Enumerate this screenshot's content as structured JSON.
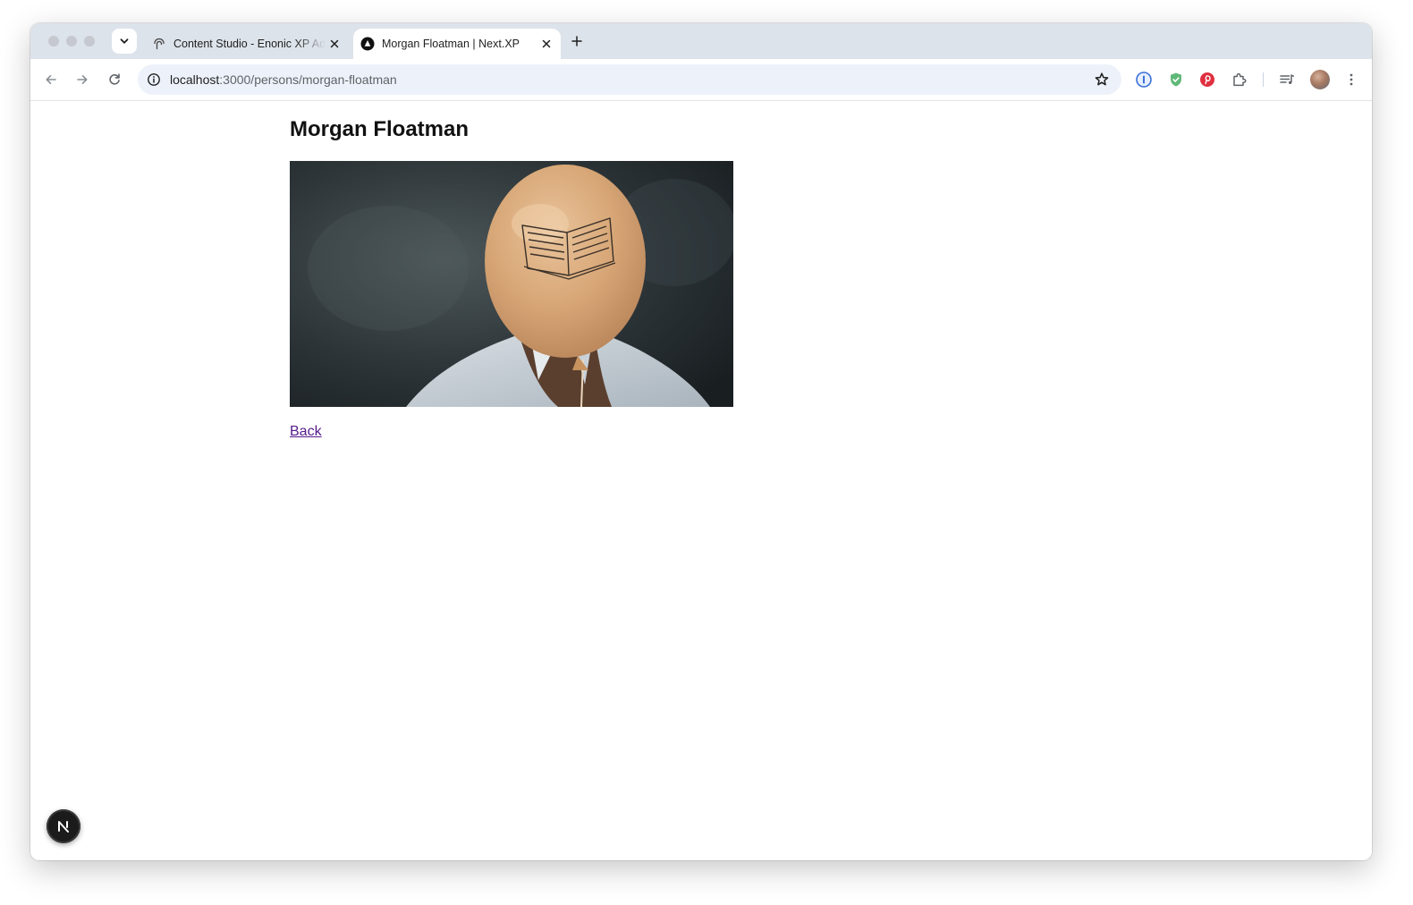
{
  "browser": {
    "tabs": [
      {
        "title": "Content Studio - Enonic XP Admin",
        "favicon": "enonic-icon",
        "active": false
      },
      {
        "title": "Morgan Floatman | Next.XP",
        "favicon": "nextjs-triangle-icon",
        "active": true
      }
    ],
    "address": {
      "host": "localhost",
      "path": ":3000/persons/morgan-floatman"
    },
    "extensions": [
      "onepassword-icon",
      "shield-check-icon",
      "pinterest-icon",
      "puzzle-extensions-icon",
      "reading-list-icon"
    ]
  },
  "page": {
    "heading": "Morgan Floatman",
    "image_alt": "Person with a balloon with a book drawn on it in front of their face",
    "back_link": "Back"
  },
  "colors": {
    "tabstrip": "#dde3ea",
    "omnibox": "#edf2fa",
    "link_visited": "#551a8b",
    "heading": "#111111"
  }
}
